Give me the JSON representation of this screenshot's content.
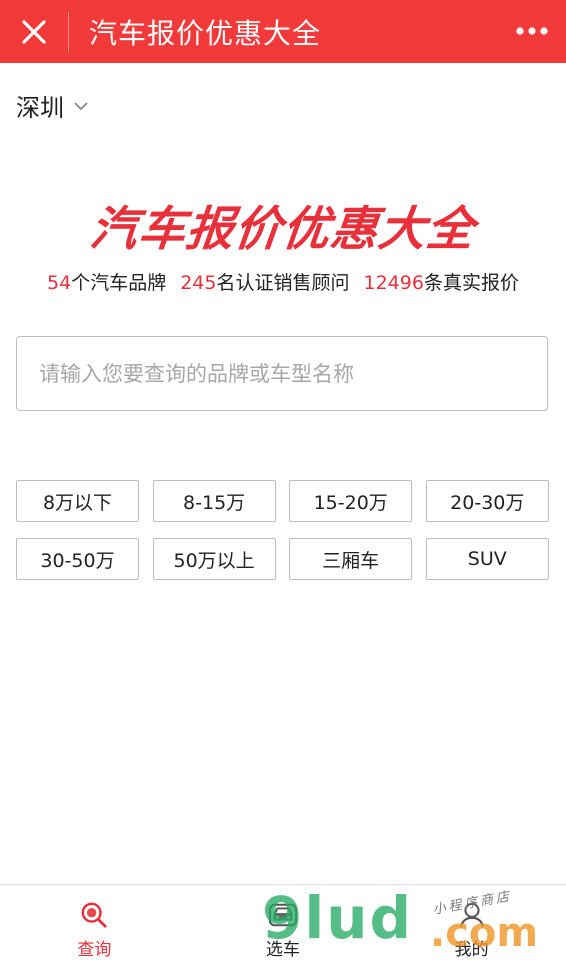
{
  "header": {
    "title": "汽车报价优惠大全",
    "close_icon": "close-icon",
    "more_icon": "more-dots-icon",
    "bg_color": "#f23a3a"
  },
  "location": {
    "city": "深圳",
    "icon": "chevron-down-icon"
  },
  "banner": {
    "title": "汽车报价优惠大全",
    "stats": [
      {
        "value": "54",
        "label": "个汽车品牌"
      },
      {
        "value": "245",
        "label": "名认证销售顾问"
      },
      {
        "value": "12496",
        "label": "条真实报价"
      }
    ],
    "accent_color": "#e8303a"
  },
  "search": {
    "placeholder": "请输入您要查询的品牌或车型名称",
    "value": ""
  },
  "filters": [
    "8万以下",
    "8-15万",
    "15-20万",
    "20-30万",
    "30-50万",
    "50万以上",
    "三厢车",
    "SUV"
  ],
  "tabs": [
    {
      "label": "查询",
      "icon": "search-icon",
      "active": true
    },
    {
      "label": "选车",
      "icon": "car-icon",
      "active": false
    },
    {
      "label": "我的",
      "icon": "user-icon",
      "active": false
    }
  ],
  "watermark": {
    "logo": "9lud",
    "domain": ".com",
    "caption": "小程序商店"
  }
}
